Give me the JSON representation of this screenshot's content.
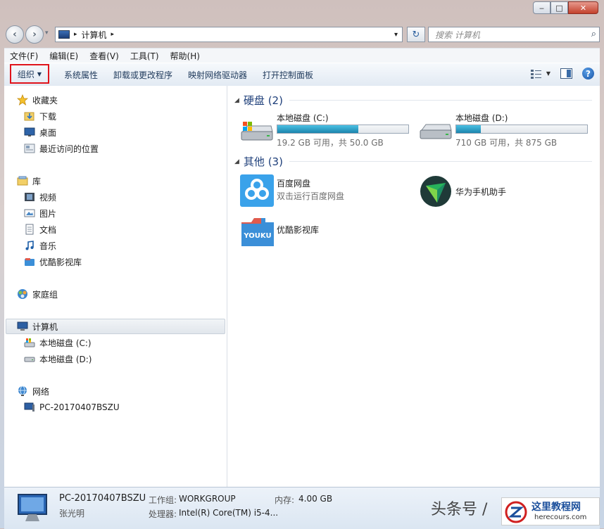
{
  "window": {
    "minimize": "‒",
    "maximize": "□",
    "close": "✕"
  },
  "nav": {
    "back": "‹",
    "forward": "›",
    "breadcrumb_sep": "▸",
    "address": "计算机",
    "address_dropdown": "▾",
    "refresh": "↻",
    "search_placeholder": "搜索 计算机",
    "search_icon": "⌕"
  },
  "menu": [
    "文件(F)",
    "编辑(E)",
    "查看(V)",
    "工具(T)",
    "帮助(H)"
  ],
  "toolbar": {
    "organize": "组织",
    "dropdown_arrow": "▼",
    "items": [
      "系统属性",
      "卸载或更改程序",
      "映射网络驱动器",
      "打开控制面板"
    ],
    "help": "?"
  },
  "sidebar": {
    "favorites": {
      "label": "收藏夹",
      "items": [
        "下载",
        "桌面",
        "最近访问的位置"
      ]
    },
    "libraries": {
      "label": "库",
      "items": [
        "视频",
        "图片",
        "文档",
        "音乐",
        "优酷影视库"
      ]
    },
    "homegroup": "家庭组",
    "computer": {
      "label": "计算机",
      "items": [
        "本地磁盘 (C:)",
        "本地磁盘 (D:)"
      ]
    },
    "network": {
      "label": "网络",
      "items": [
        "PC-20170407BSZU"
      ]
    }
  },
  "content": {
    "hard_disks": {
      "header": "硬盘 (2)",
      "collapse": "◢"
    },
    "drives": [
      {
        "name": "本地磁盘 (C:)",
        "free_text": "19.2 GB 可用，共 50.0 GB",
        "used_fraction": 0.62
      },
      {
        "name": "本地磁盘 (D:)",
        "free_text": "710 GB 可用，共 875 GB",
        "used_fraction": 0.19
      }
    ],
    "other": {
      "header": "其他 (3)",
      "collapse": "◢"
    },
    "apps": [
      {
        "name": "百度网盘",
        "desc": "双击运行百度网盘"
      },
      {
        "name": "华为手机助手",
        "desc": ""
      },
      {
        "name": "优酷影视库",
        "desc": ""
      }
    ],
    "youku_logo": "YOUKU"
  },
  "status": {
    "computer_name": "PC-20170407BSZU",
    "user": "张光明",
    "workgroup_label": "工作组:",
    "workgroup": "WORKGROUP",
    "memory_label": "内存:",
    "memory": "4.00 GB",
    "cpu_label": "处理器:",
    "cpu": "Intel(R) Core(TM) i5-4..."
  },
  "watermark": {
    "left": "头条号 /",
    "site_title": "这里教程网",
    "site_url": "herecours.com"
  },
  "colors": {
    "accent": "#1e3f7a",
    "highlight": "#e0141b",
    "progress": "#26a0c8"
  }
}
